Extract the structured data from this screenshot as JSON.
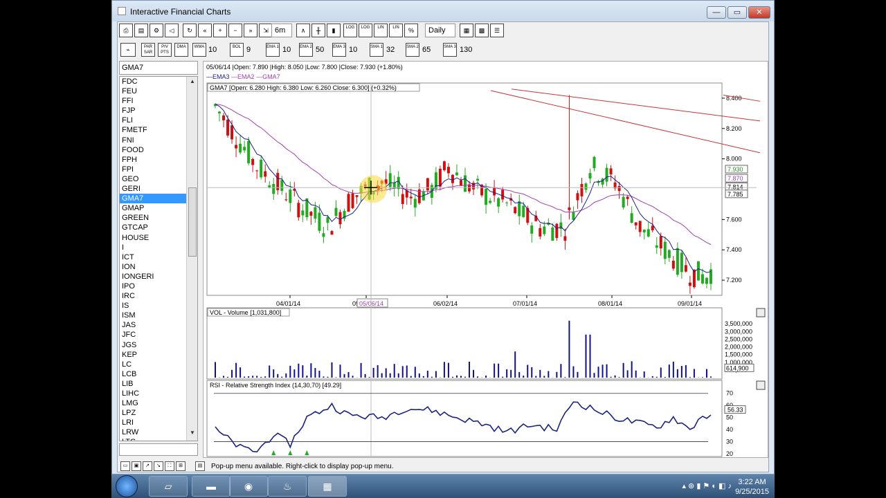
{
  "window": {
    "title": "Interactive Financial Charts",
    "minimize": "—",
    "maximize": "▭",
    "close": "✕"
  },
  "toolbar1": {
    "icons": [
      "print",
      "page-setup",
      "settings",
      "sound",
      "refresh",
      "back",
      "zoom-in",
      "zoom-out",
      "forward",
      "fit"
    ],
    "period": "6m",
    "chart_types": [
      "line",
      "ohlc",
      "candle"
    ],
    "scale_buttons": [
      "LOG",
      "LOG",
      "LIN",
      "LIN",
      "%"
    ],
    "interval": "Daily"
  },
  "toolbar2": {
    "buttons": [
      {
        "label": "PAR SAR"
      },
      {
        "label": "PIV PTS"
      },
      {
        "label": "DMA"
      },
      {
        "label": "WMA",
        "value": "10"
      },
      {
        "label": "BOL",
        "value": "9"
      },
      {
        "label": "EMA 1",
        "value": "10"
      },
      {
        "label": "EMA 2",
        "value": "50"
      },
      {
        "label": "EMA 3",
        "value": "10"
      },
      {
        "label": "SMA 1",
        "value": "32"
      },
      {
        "label": "SMA 2",
        "value": "65"
      },
      {
        "label": "SMA 3",
        "value": "130"
      }
    ]
  },
  "symbols": {
    "current": "GMA7",
    "items": [
      "FDC",
      "FEU",
      "FFI",
      "FJP",
      "FLI",
      "FMETF",
      "FNI",
      "FOOD",
      "FPH",
      "FPI",
      "GEO",
      "GERI",
      "GMA7",
      "GMAP",
      "GREEN",
      "GTCAP",
      "HOUSE",
      "I",
      "ICT",
      "ION",
      "IONGERI",
      "IPO",
      "IRC",
      "IS",
      "ISM",
      "JAS",
      "JFC",
      "JGS",
      "KEP",
      "LC",
      "LCB",
      "LIB",
      "LIHC",
      "LMG",
      "LPZ",
      "LRI",
      "LRW",
      "LTG"
    ],
    "selected_index": 12
  },
  "chart": {
    "cursor_info": "05/06/14 |Open: 7.890 |High: 8.050 |Low: 7.800 |Close: 7.930 (+1.80%)",
    "legend": [
      "EMA3",
      "EMA2",
      "GMA7"
    ],
    "price_header": "GMA7 [Open: 6.280  High: 6.380  Low: 6.260  Close: 6.300] (+0.32%)",
    "volume_header": "VOL - Volume [1,031,800]",
    "rsi_header": "RSI - Relative Strength Index (14,30,70) [49.29]",
    "date_labels": [
      "04/01/14",
      "05/01/14",
      "06/02/14",
      "07/01/14",
      "08/01/14",
      "09/01/14"
    ],
    "cursor_date": "05/06/14",
    "price_axis": [
      "8.400",
      "8.200",
      "8.000",
      "7.600",
      "7.400",
      "7.200"
    ],
    "price_tags": {
      "a": "7.930",
      "b": "7.870",
      "c": "7.814",
      "d": "7.785"
    },
    "volume_axis": [
      "3,500,000",
      "3,000,000",
      "2,500,000",
      "2,000,000",
      "1,500,000",
      "1,000,000",
      "500,000"
    ],
    "volume_tag": "614,900",
    "rsi_axis": [
      "70",
      "60",
      "50",
      "40",
      "30",
      "20"
    ],
    "rsi_tag": "56.33",
    "colors": {
      "up": "#22aa22",
      "down": "#cc1111",
      "ema3": "#1c1c8c",
      "ema2": "#a040b0",
      "trend": "#cc3333",
      "volume": "#10108a",
      "rsi": "#1a237e"
    }
  },
  "chart_data": [
    {
      "type": "line",
      "title": "GMA7",
      "ylim": [
        7.1,
        8.5
      ],
      "x": [
        "04/01/14",
        "05/01/14",
        "06/02/14",
        "07/01/14",
        "08/01/14",
        "09/01/14"
      ],
      "series": [
        {
          "name": "EMA2",
          "values": [
            7.98,
            7.86,
            7.8,
            7.72,
            7.58,
            7.4
          ]
        },
        {
          "name": "EMA3",
          "values": [
            7.62,
            7.78,
            7.71,
            7.7,
            7.44,
            7.27
          ]
        }
      ]
    },
    {
      "type": "bar",
      "title": "VOL - Volume",
      "ylim": [
        0,
        4000000
      ],
      "categories": [
        "04/01/14",
        "05/01/14",
        "06/02/14",
        "07/01/14",
        "08/01/14",
        "09/01/14"
      ],
      "values": [
        1200000,
        1000000,
        600000,
        3700000,
        1000000,
        614900
      ]
    },
    {
      "type": "line",
      "title": "RSI - Relative Strength Index",
      "ylim": [
        20,
        75
      ],
      "x": [
        "04/01/14",
        "05/01/14",
        "06/02/14",
        "07/01/14",
        "08/01/14",
        "09/01/14"
      ],
      "series": [
        {
          "name": "RSI",
          "values": [
            25,
            50,
            42,
            64,
            48,
            49.29
          ]
        }
      ]
    }
  ],
  "status": {
    "message": "Pop-up menu available. Right-click to display pop-up menu."
  },
  "taskbar": {
    "time": "3:22 AM",
    "date": "9/25/2015"
  }
}
